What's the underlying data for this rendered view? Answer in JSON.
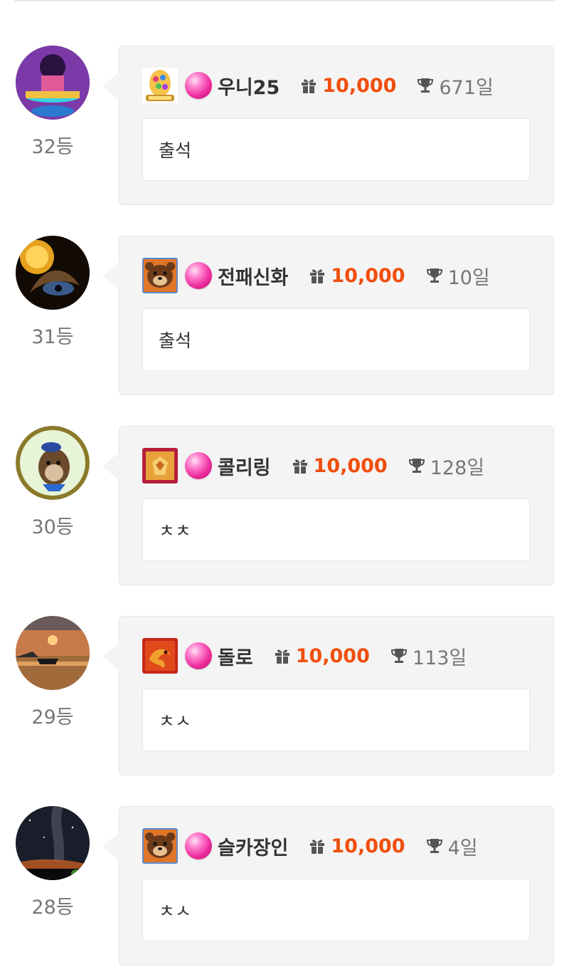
{
  "entries": [
    {
      "rank": "32등",
      "name": "우니25",
      "points": "10,000",
      "days": "671일",
      "message": "출석",
      "badge_icon": "egg-lotto-badge-icon",
      "avatar_icon": "fantasy-character-avatar"
    },
    {
      "rank": "31등",
      "name": "전패신화",
      "points": "10,000",
      "days": "10일",
      "message": "출석",
      "badge_icon": "bear-badge-icon",
      "avatar_icon": "cosmic-eclipse-avatar"
    },
    {
      "rank": "30등",
      "name": "콜리링",
      "points": "10,000",
      "days": "128일",
      "message": "ㅊㅊ",
      "badge_icon": "golden-crest-badge-icon",
      "avatar_icon": "otter-mascot-avatar"
    },
    {
      "rank": "29등",
      "name": "돌로",
      "points": "10,000",
      "days": "113일",
      "message": "ㅊㅅ",
      "badge_icon": "red-dragon-badge-icon",
      "avatar_icon": "sunset-sea-avatar"
    },
    {
      "rank": "28등",
      "name": "슬카장인",
      "points": "10,000",
      "days": "4일",
      "message": "ㅊㅅ",
      "badge_icon": "bear-badge-icon",
      "avatar_icon": "night-sky-avatar"
    }
  ],
  "colors": {
    "points": "#f04e0c",
    "card_bg": "#f4f4f4",
    "orb": "#ec2b9c",
    "rank_text": "#777777"
  },
  "icons": {
    "points_icon": "gift-icon",
    "days_icon": "trophy-icon",
    "level_icon": "pink-orb-icon"
  }
}
